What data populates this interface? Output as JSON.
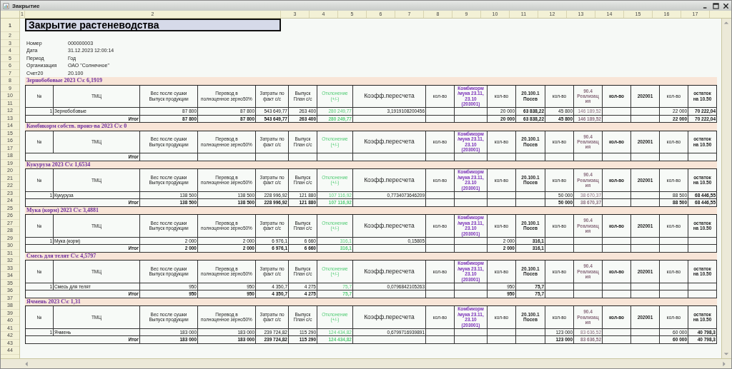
{
  "window": {
    "title": "Закрытие"
  },
  "column_numbers": [
    "1",
    "2",
    "3",
    "4",
    "5",
    "6",
    "7",
    "8",
    "9",
    "10",
    "11",
    "12",
    "13",
    "14",
    "15",
    "16",
    "17"
  ],
  "row_numbers": [
    "1",
    "2",
    "3",
    "4",
    "5",
    "6",
    "7",
    "8",
    "9",
    "10",
    "11",
    "12",
    "13",
    "14",
    "15",
    "16",
    "17",
    "18",
    "19",
    "20",
    "21",
    "22",
    "23",
    "24",
    "25",
    "26",
    "27",
    "28",
    "29",
    "30",
    "31",
    "32",
    "33",
    "34",
    "35",
    "36",
    "37",
    "38",
    "39",
    "40",
    "41",
    "42",
    "43",
    "44"
  ],
  "report": {
    "title": "Закрытие растеневодства",
    "fields": [
      {
        "label": "Номер",
        "value": "000000003"
      },
      {
        "label": "Дата",
        "value": "31.12.2023 12:00:14"
      },
      {
        "label": "Период",
        "value": "Год"
      },
      {
        "label": "Организация",
        "value": "ОАО \"Солнечное\""
      },
      {
        "label": "Счет20",
        "value": "20.100"
      }
    ]
  },
  "sections": [
    {
      "title": "Зернобобовые 2023 С\\с 6,1919",
      "columns": [
        {
          "label": "№",
          "kind": "plain"
        },
        {
          "label": "ТМЦ",
          "kind": "plain"
        },
        {
          "label": "Вес после сушки\nВыпуск продукции",
          "kind": "plain"
        },
        {
          "label": "Перевод в\nполноценное зерно50%",
          "kind": "plain"
        },
        {
          "label": "Затраты по\nфакт с/с",
          "kind": "plain"
        },
        {
          "label": "Выпуск\nПлан с/с",
          "kind": "plain"
        },
        {
          "label": "Отклонение\n(+/-)",
          "kind": "green"
        },
        {
          "label": "Коэфф.пересчета",
          "kind": "large"
        },
        {
          "label": "кол-во",
          "kind": "plain"
        },
        {
          "label": "Комбикорм\n/мука 23.11,\n23.10\n(203001)",
          "kind": "purple"
        },
        {
          "label": "кол-во",
          "kind": "plain"
        },
        {
          "label": "20.100.1\nПосев",
          "kind": "bold"
        },
        {
          "label": "кол-во",
          "kind": "plain"
        },
        {
          "label": "90.4\nРеализац\nия",
          "kind": "mauve"
        },
        {
          "label": "кол-во",
          "kind": "bold"
        },
        {
          "label": "202001",
          "kind": "bold"
        },
        {
          "label": "кол-во",
          "kind": "plain"
        },
        {
          "label": "остаток\nна 10.50",
          "kind": "bold"
        }
      ],
      "rows": [
        {
          "kind": "item",
          "cells": [
            "1",
            "Зернобобовые",
            "87 800",
            "87 800",
            "543 649,77",
            "263 400",
            "280 249,77",
            "3,1919108200456",
            null,
            null,
            "20 000",
            "63 838,22",
            "45 800",
            "146 189,52",
            null,
            null,
            "22 000",
            "70 222,04"
          ]
        },
        {
          "kind": "total",
          "cells": [
            null,
            "Итог",
            "87 800",
            "87 800",
            "543 649,77",
            "263 400",
            "280 249,77",
            null,
            null,
            null,
            "20 000",
            "63 838,22",
            "45 800",
            "146 189,52",
            null,
            null,
            "22 000",
            "70 222,04"
          ]
        }
      ]
    },
    {
      "title": "Комбикорм собств. произ-ва 2023 С\\с 0",
      "columns": [
        {
          "label": "№",
          "kind": "plain"
        },
        {
          "label": "ТМЦ",
          "kind": "plain"
        },
        {
          "label": "Вес после сушки\nВыпуск продукции",
          "kind": "plain"
        },
        {
          "label": "Перевод в\nполноценное зерно50%",
          "kind": "plain"
        },
        {
          "label": "Затраты по\nфакт с/с",
          "kind": "plain"
        },
        {
          "label": "Выпуск\nПлан с/с",
          "kind": "plain"
        },
        {
          "label": "Отклонение\n(+/-)",
          "kind": "green"
        },
        {
          "label": "Коэфф.пересчета",
          "kind": "large"
        },
        {
          "label": "кол-во",
          "kind": "plain"
        },
        {
          "label": "Комбикорм\n/мука 23.11,\n23.10\n(203001)",
          "kind": "purple"
        },
        {
          "label": "кол-во",
          "kind": "plain"
        },
        {
          "label": "20.100.1\nПосев",
          "kind": "bold"
        },
        {
          "label": "кол-во",
          "kind": "plain"
        },
        {
          "label": "90.4\nРеализац\nия",
          "kind": "mauve"
        },
        {
          "label": "кол-во",
          "kind": "bold"
        },
        {
          "label": "202001",
          "kind": "bold"
        },
        {
          "label": "кол-во",
          "kind": "plain"
        },
        {
          "label": "остаток\nна 10.50",
          "kind": "bold"
        }
      ],
      "rows": [
        {
          "kind": "total",
          "cells": [
            null,
            "Итог",
            null,
            null,
            null,
            null,
            null,
            null,
            null,
            null,
            null,
            null,
            null,
            null,
            null,
            null,
            null,
            null
          ]
        }
      ]
    },
    {
      "title": "Кукуруза 2023 С\\с 1,6534",
      "columns": [
        {
          "label": "№",
          "kind": "plain"
        },
        {
          "label": "ТМЦ",
          "kind": "plain"
        },
        {
          "label": "Вес после сушки\nВыпуск продукции",
          "kind": "plain"
        },
        {
          "label": "Перевод в\nполноценное зерно50%",
          "kind": "plain"
        },
        {
          "label": "Затраты по\nфакт с/с",
          "kind": "plain"
        },
        {
          "label": "Выпуск\nПлан с/с",
          "kind": "plain"
        },
        {
          "label": "Отклонение\n(+/-)",
          "kind": "green"
        },
        {
          "label": "Коэфф.пересчета",
          "kind": "large"
        },
        {
          "label": "кол-во",
          "kind": "plain"
        },
        {
          "label": "Комбикорм\n/мука 23.11,\n23.10\n(203001)",
          "kind": "purple"
        },
        {
          "label": "кол-во",
          "kind": "plain"
        },
        {
          "label": "20.100.1\nПосев",
          "kind": "bold"
        },
        {
          "label": "кол-во",
          "kind": "plain"
        },
        {
          "label": "90.4\nРеализац\nия",
          "kind": "mauve"
        },
        {
          "label": "кол-во",
          "kind": "bold"
        },
        {
          "label": "202001",
          "kind": "bold"
        },
        {
          "label": "кол-во",
          "kind": "plain"
        },
        {
          "label": "остаток\nна 10.50",
          "kind": "bold"
        }
      ],
      "rows": [
        {
          "kind": "item",
          "cells": [
            "1",
            "Кукуруза",
            "138 500",
            "138 500",
            "228 996,92",
            "121 880",
            "107 116,92",
            "0,7734073646209",
            null,
            null,
            null,
            null,
            "50 000",
            "38 670,37",
            null,
            null,
            "88 500",
            "68 446,55"
          ]
        },
        {
          "kind": "total",
          "cells": [
            null,
            "Итог",
            "138 500",
            "138 500",
            "228 996,92",
            "121 880",
            "107 116,92",
            null,
            null,
            null,
            null,
            null,
            "50 000",
            "38 670,37",
            null,
            null,
            "88 500",
            "68 446,55"
          ]
        }
      ]
    },
    {
      "title": "Мука (корм) 2023 С\\с 3,4881",
      "columns": [
        {
          "label": "№",
          "kind": "plain"
        },
        {
          "label": "ТМЦ",
          "kind": "plain"
        },
        {
          "label": "Вес после сушки\nВыпуск продукции",
          "kind": "plain"
        },
        {
          "label": "Перевод в\nполноценное зерно50%",
          "kind": "plain"
        },
        {
          "label": "Затраты по\nфакт с/с",
          "kind": "plain"
        },
        {
          "label": "Выпуск\nПлан с/с",
          "kind": "plain"
        },
        {
          "label": "Отклонение\n(+/-)",
          "kind": "green"
        },
        {
          "label": "Коэфф.пересчета",
          "kind": "large"
        },
        {
          "label": "кол-во",
          "kind": "plain"
        },
        {
          "label": "Комбикорм\n/мука 23.11,\n23.10\n(203001)",
          "kind": "purple"
        },
        {
          "label": "кол-во",
          "kind": "plain"
        },
        {
          "label": "20.100.1\nПосев",
          "kind": "bold"
        },
        {
          "label": "кол-во",
          "kind": "plain"
        },
        {
          "label": "90.4\nРеализац\nия",
          "kind": "mauve"
        },
        {
          "label": "кол-во",
          "kind": "bold"
        },
        {
          "label": "202001",
          "kind": "bold"
        },
        {
          "label": "кол-во",
          "kind": "plain"
        },
        {
          "label": "остаток\nна 10.50",
          "kind": "bold"
        }
      ],
      "rows": [
        {
          "kind": "item",
          "cells": [
            "1",
            "Мука (корм)",
            "2 000",
            "2 000",
            "6 976,1",
            "6 660",
            "316,1",
            "0,15805",
            null,
            null,
            "2 000",
            "316,1",
            null,
            null,
            null,
            null,
            null,
            null
          ]
        },
        {
          "kind": "total",
          "cells": [
            null,
            "Итог",
            "2 000",
            "2 000",
            "6 976,1",
            "6 660",
            "316,1",
            null,
            null,
            null,
            "2 000",
            "316,1",
            null,
            null,
            null,
            null,
            null,
            null
          ]
        }
      ]
    },
    {
      "title": "Смесь для телят С\\с 4,5797",
      "columns": [
        {
          "label": "№",
          "kind": "plain"
        },
        {
          "label": "ТМЦ",
          "kind": "plain"
        },
        {
          "label": "Вес после сушки\nВыпуск продукции",
          "kind": "plain"
        },
        {
          "label": "Перевод в\nполноценное зерно50%",
          "kind": "plain"
        },
        {
          "label": "Затраты по\nфакт с/с",
          "kind": "plain"
        },
        {
          "label": "Выпуск\nПлан с/с",
          "kind": "plain"
        },
        {
          "label": "Отклонение\n(+/-)",
          "kind": "green"
        },
        {
          "label": "Коэфф.пересчета",
          "kind": "large"
        },
        {
          "label": "кол-во",
          "kind": "plain"
        },
        {
          "label": "Комбикорм\n/мука 23.11,\n23.10\n(203001)",
          "kind": "purple"
        },
        {
          "label": "кол-во",
          "kind": "plain"
        },
        {
          "label": "20.100.1\nПосев",
          "kind": "bold"
        },
        {
          "label": "кол-во",
          "kind": "plain"
        },
        {
          "label": "90.4\nРеализац\nия",
          "kind": "mauve"
        },
        {
          "label": "кол-во",
          "kind": "bold"
        },
        {
          "label": "202001",
          "kind": "bold"
        },
        {
          "label": "кол-во",
          "kind": "plain"
        },
        {
          "label": "остаток\nна 10.50",
          "kind": "bold"
        }
      ],
      "rows": [
        {
          "kind": "item",
          "cells": [
            "1",
            "Смесь для телят",
            "950",
            "950",
            "4 350,7",
            "4 275",
            "75,7",
            "0,0796842105263",
            null,
            null,
            "950",
            "75,7",
            null,
            null,
            null,
            null,
            null,
            null
          ]
        },
        {
          "kind": "total",
          "cells": [
            null,
            "Итог",
            "950",
            "950",
            "4 350,7",
            "4 275",
            "75,7",
            null,
            null,
            null,
            "950",
            "75,7",
            null,
            null,
            null,
            null,
            null,
            null
          ]
        }
      ]
    },
    {
      "title": "Ячмень 2023 С\\с 1,31",
      "columns": [
        {
          "label": "№",
          "kind": "plain"
        },
        {
          "label": "ТМЦ",
          "kind": "plain"
        },
        {
          "label": "Вес после сушки\nВыпуск продукции",
          "kind": "plain"
        },
        {
          "label": "Перевод в\nполноценное зерно50%",
          "kind": "plain"
        },
        {
          "label": "Затраты по\nфакт с/с",
          "kind": "plain"
        },
        {
          "label": "Выпуск\nПлан с/с",
          "kind": "plain"
        },
        {
          "label": "Отклонение\n(+/-)",
          "kind": "green"
        },
        {
          "label": "Коэфф.пересчета",
          "kind": "large"
        },
        {
          "label": "кол-во",
          "kind": "plain"
        },
        {
          "label": "Комбикорм\n/мука 23.11,\n23.10\n(203001)",
          "kind": "purple"
        },
        {
          "label": "кол-во",
          "kind": "plain"
        },
        {
          "label": "20.100.1\nПосев",
          "kind": "bold"
        },
        {
          "label": "кол-во",
          "kind": "plain"
        },
        {
          "label": "90.4\nРеализац\nия",
          "kind": "mauve"
        },
        {
          "label": "кол-во",
          "kind": "bold"
        },
        {
          "label": "202001",
          "kind": "bold"
        },
        {
          "label": "кол-во",
          "kind": "plain"
        },
        {
          "label": "остаток\nна 10.50",
          "kind": "bold"
        }
      ],
      "rows": [
        {
          "kind": "item",
          "cells": [
            "1",
            "Ячмень",
            "183 000",
            "183 000",
            "239 724,82",
            "115 290",
            "124 434,82",
            "0,6799716939891",
            null,
            null,
            null,
            null,
            "123 000",
            "83 636,52",
            null,
            null,
            "60 000",
            "40 798,3"
          ]
        },
        {
          "kind": "total",
          "cells": [
            null,
            "Итог",
            "183 000",
            "183 000",
            "239 724,82",
            "115 290",
            "124 434,82",
            null,
            null,
            null,
            null,
            null,
            "123 000",
            "83 636,52",
            null,
            null,
            "60 000",
            "40 798,3"
          ]
        }
      ]
    }
  ]
}
